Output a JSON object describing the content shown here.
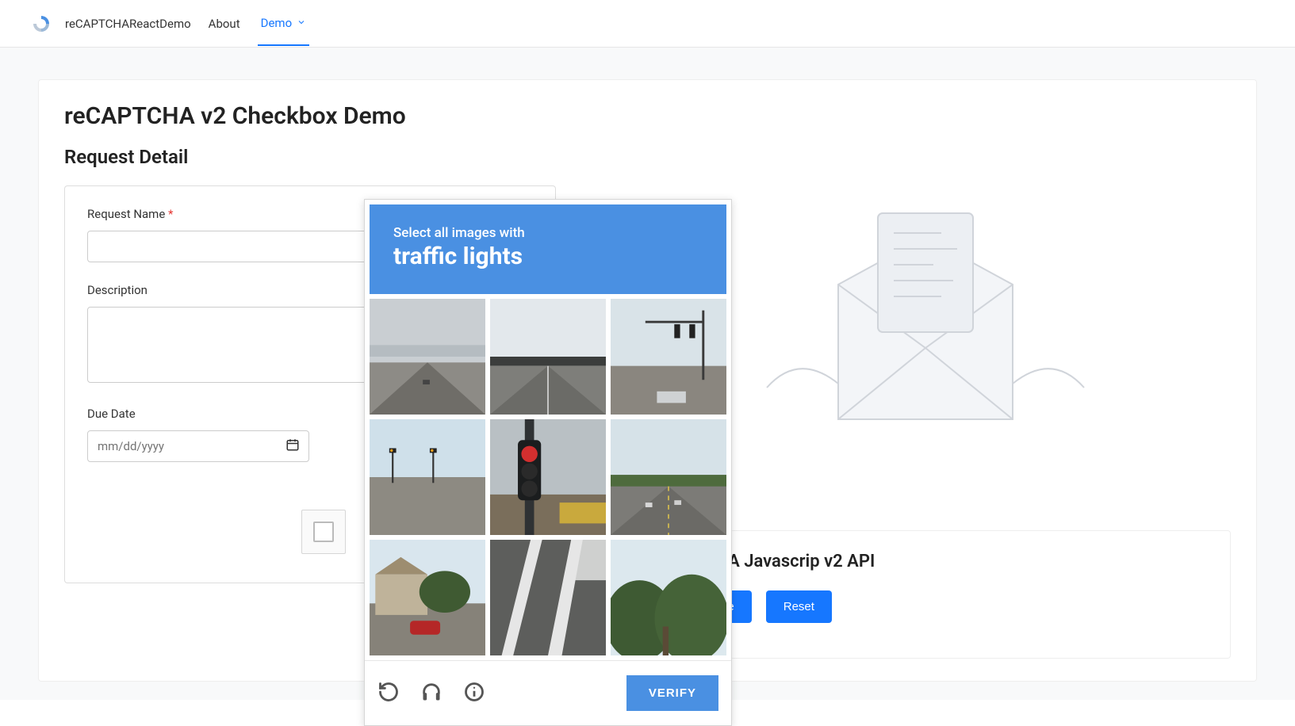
{
  "nav": {
    "brand": "reCAPTCHAReactDemo",
    "about": "About",
    "demo": "Demo"
  },
  "page": {
    "title": "reCAPTCHA v2 Checkbox Demo",
    "section_title": "Request Detail"
  },
  "form": {
    "request_name_label": "Request Name",
    "required_mark": "*",
    "description_label": "Description",
    "due_date_label": "Due Date",
    "date_placeholder": "mm/dd/yyyy"
  },
  "captcha": {
    "instruction_line1": "Select all images with",
    "instruction_subject": "traffic lights",
    "verify_label": "VERIFY"
  },
  "right_panel": {
    "api_title": "reCAPTCHA Javascrip v2 API",
    "get_response": "GetResponse",
    "reset": "Reset"
  }
}
